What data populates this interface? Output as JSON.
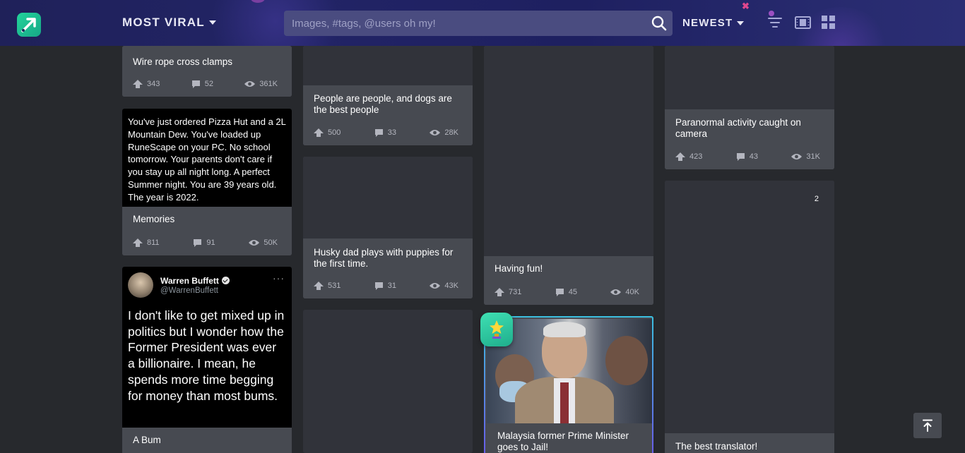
{
  "header": {
    "sort_main": "MOST VIRAL",
    "search_placeholder": "Images, #tags, @users oh my!",
    "sort_secondary": "NEWEST",
    "close_mark": "✖"
  },
  "icons": {
    "logo": "imgur-logo-icon",
    "search": "search-icon",
    "filter": "filter-lines-icon",
    "film": "film-view-icon",
    "grid": "grid-view-icon",
    "upvote": "upvote-arrow-icon",
    "comment": "comment-bubble-icon",
    "views": "eye-icon",
    "trophy": "trophy-icon",
    "back_to_top": "back-to-top-icon"
  },
  "colors": {
    "header_bg": "#1f2159",
    "page_bg": "#27292d",
    "card_bg": "#474a51",
    "logo_green": "#23d49b",
    "accent_pink": "#e0478e"
  },
  "posts": {
    "wire_rope": {
      "title": "Wire rope cross clamps",
      "upvotes": "343",
      "comments": "52",
      "views": "361K"
    },
    "memories": {
      "media_text": "You've just ordered Pizza Hut and a 2L Mountain Dew. You've loaded up RuneScape on your PC. No school tomorrow. Your parents don't care if you stay up all night long. A perfect Summer night. You are 39 years old. The year is 2022.",
      "title": "Memories",
      "upvotes": "811",
      "comments": "91",
      "views": "50K"
    },
    "a_bum": {
      "tweet_name": "Warren Buffett",
      "tweet_handle": "@WarrenBuffett",
      "tweet_more": "···",
      "tweet_text": "I don't like to get mixed up in politics but I wonder how the Former President was ever a billionaire. I mean, he spends more time begging for money than most bums.",
      "title": "A Bum"
    },
    "dogs": {
      "title": "People are people, and dogs are the best people",
      "upvotes": "500",
      "comments": "33",
      "views": "28K"
    },
    "husky": {
      "title": "Husky dad plays with puppies for the first time.",
      "upvotes": "531",
      "comments": "31",
      "views": "43K"
    },
    "having_fun": {
      "title": "Having fun!",
      "upvotes": "731",
      "comments": "45",
      "views": "40K"
    },
    "malaysia": {
      "title": "Malaysia former Prime Minister goes to Jail!"
    },
    "paranormal": {
      "title": "Paranormal activity caught on camera",
      "upvotes": "423",
      "comments": "43",
      "views": "31K"
    },
    "translator": {
      "title": "The best translator!",
      "album_count": "2"
    }
  }
}
